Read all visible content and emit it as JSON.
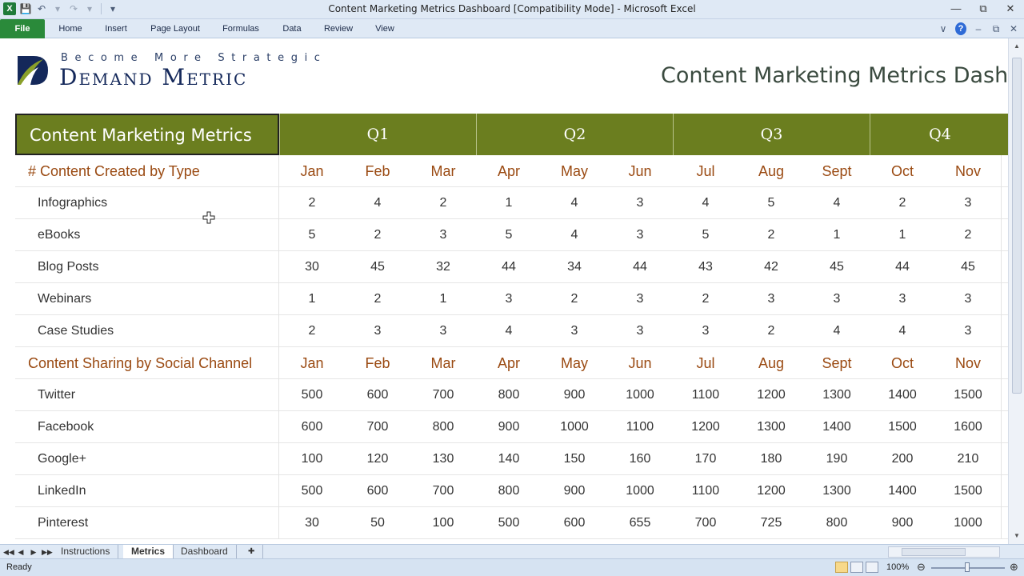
{
  "window": {
    "title": "Content Marketing Metrics Dashboard  [Compatibility Mode]  -  Microsoft Excel"
  },
  "ribbon": {
    "tabs": [
      "File",
      "Home",
      "Insert",
      "Page Layout",
      "Formulas",
      "Data",
      "Review",
      "View"
    ]
  },
  "logo": {
    "tagline": "Become More Strategic",
    "brand": "Demand Metric"
  },
  "dashboard_title": "Content Marketing Metrics Dashb",
  "grid": {
    "header_label": "Content Marketing Metrics",
    "quarters": [
      "Q1",
      "Q2",
      "Q3",
      "Q4"
    ],
    "sections": [
      {
        "title": "# Content Created by Type",
        "months": [
          "Jan",
          "Feb",
          "Mar",
          "Apr",
          "May",
          "Jun",
          "Jul",
          "Aug",
          "Sept",
          "Oct",
          "Nov"
        ],
        "rows": [
          {
            "label": "Infographics",
            "values": [
              "2",
              "4",
              "2",
              "1",
              "4",
              "3",
              "4",
              "5",
              "4",
              "2",
              "3"
            ]
          },
          {
            "label": "eBooks",
            "values": [
              "5",
              "2",
              "3",
              "5",
              "4",
              "3",
              "5",
              "2",
              "1",
              "1",
              "2"
            ]
          },
          {
            "label": "Blog Posts",
            "values": [
              "30",
              "45",
              "32",
              "44",
              "34",
              "44",
              "43",
              "42",
              "45",
              "44",
              "45"
            ]
          },
          {
            "label": "Webinars",
            "values": [
              "1",
              "2",
              "1",
              "3",
              "2",
              "3",
              "2",
              "3",
              "3",
              "3",
              "3"
            ]
          },
          {
            "label": "Case Studies",
            "values": [
              "2",
              "3",
              "3",
              "4",
              "3",
              "3",
              "3",
              "2",
              "4",
              "4",
              "3"
            ]
          }
        ]
      },
      {
        "title": "Content Sharing by Social Channel",
        "months": [
          "Jan",
          "Feb",
          "Mar",
          "Apr",
          "May",
          "Jun",
          "Jul",
          "Aug",
          "Sept",
          "Oct",
          "Nov"
        ],
        "rows": [
          {
            "label": "Twitter",
            "values": [
              "500",
              "600",
              "700",
              "800",
              "900",
              "1000",
              "1100",
              "1200",
              "1300",
              "1400",
              "1500"
            ]
          },
          {
            "label": "Facebook",
            "values": [
              "600",
              "700",
              "800",
              "900",
              "1000",
              "1100",
              "1200",
              "1300",
              "1400",
              "1500",
              "1600"
            ]
          },
          {
            "label": "Google+",
            "values": [
              "100",
              "120",
              "130",
              "140",
              "150",
              "160",
              "170",
              "180",
              "190",
              "200",
              "210"
            ]
          },
          {
            "label": "LinkedIn",
            "values": [
              "500",
              "600",
              "700",
              "800",
              "900",
              "1000",
              "1100",
              "1200",
              "1300",
              "1400",
              "1500"
            ]
          },
          {
            "label": "Pinterest",
            "values": [
              "30",
              "50",
              "100",
              "500",
              "600",
              "655",
              "700",
              "725",
              "800",
              "900",
              "1000"
            ]
          }
        ]
      }
    ]
  },
  "sheet_tabs": [
    {
      "label": "Instructions",
      "active": false
    },
    {
      "label": "Metrics",
      "active": true
    },
    {
      "label": "Dashboard",
      "active": false
    }
  ],
  "status": {
    "ready": "Ready",
    "zoom": "100%"
  },
  "colors": {
    "header_green": "#6b7e1f",
    "section_text": "#9a4a12",
    "brand_navy": "#14285a",
    "file_tab": "#2a8a3a"
  }
}
